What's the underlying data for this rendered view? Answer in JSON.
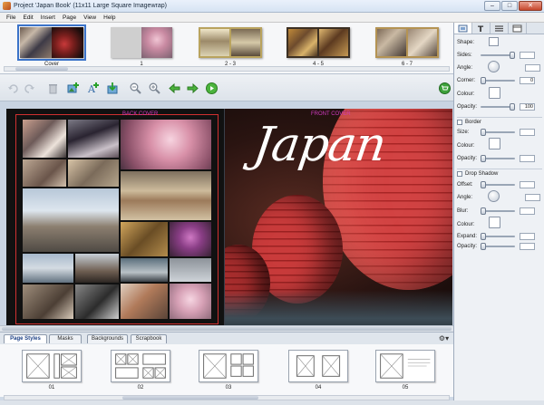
{
  "window": {
    "title": "Project 'Japan Book' (11x11 Large Square Imagewrap)",
    "min": "–",
    "max": "□",
    "close": "✕"
  },
  "menu": [
    "File",
    "Edit",
    "Insert",
    "Page",
    "View",
    "Help"
  ],
  "thumbnails": [
    {
      "label": "Cover",
      "selected": true
    },
    {
      "label": "1"
    },
    {
      "label": "2 - 3"
    },
    {
      "label": "4 - 5"
    },
    {
      "label": "6 - 7"
    }
  ],
  "toolbar": {
    "icons": [
      "undo-icon",
      "redo-icon",
      "delete-icon",
      "add-image-icon",
      "add-text-icon",
      "export-icon",
      "zoom-out-icon",
      "zoom-in-icon",
      "previous-page-icon",
      "next-page-icon",
      "play-icon",
      "cart-icon"
    ]
  },
  "spread": {
    "cover_label_left": "BACK COVER",
    "cover_label_right": "FRONT COVER",
    "title_text": "Japan"
  },
  "bottom_tabs": [
    "Page Styles",
    "Masks",
    "Backgrounds",
    "Scrapbook"
  ],
  "layouts": [
    "01",
    "02",
    "03",
    "04",
    "05"
  ],
  "panel": {
    "tabs": [
      "shape-tab-icon",
      "text-tab-icon",
      "list-tab-icon",
      "page-tab-icon"
    ],
    "shape": {
      "shape_label": "Shape:",
      "sides_label": "Sides:",
      "angle_label": "Angle:",
      "corner_label": "Corner:",
      "corner_value": "0",
      "colour_label": "Colour:",
      "opacity_label": "Opacity:",
      "opacity_value": "100"
    },
    "border": {
      "title": "Border",
      "size_label": "Size:",
      "colour_label": "Colour:",
      "opacity_label": "Opacity:"
    },
    "shadow": {
      "title": "Drop Shadow",
      "offset_label": "Offset:",
      "angle_label": "Angle:",
      "blur_label": "Blur:",
      "colour_label": "Colour:",
      "expand_label": "Expand:",
      "opacity_label": "Opacity:"
    }
  },
  "colors": {
    "accent": "#3b73c9",
    "guide": "#d03030",
    "cover_label": "#d13ac0"
  }
}
